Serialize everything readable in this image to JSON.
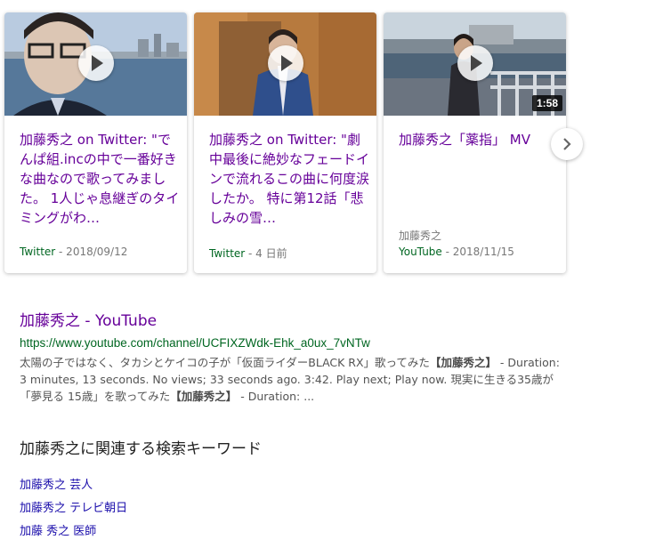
{
  "carousel": {
    "cards": [
      {
        "title": "加藤秀之 on Twitter: \"でんぱ組.incの中で一番好きな曲なので歌ってみました。 1人じゃ息継ぎのタイミングがわ…",
        "author": "",
        "source": "Twitter",
        "date": " - 2018/09/12",
        "duration": ""
      },
      {
        "title": "加藤秀之 on Twitter: \"劇中最後に絶妙なフェードインで流れるこの曲に何度涙したか。 特に第12話「悲しみの雪…",
        "author": "",
        "source": "Twitter",
        "date": " - 4 日前",
        "duration": ""
      },
      {
        "title": "加藤秀之「薬指」 MV",
        "author": "加藤秀之",
        "source": "YouTube",
        "date": " - 2018/11/15",
        "duration": "1:58"
      }
    ]
  },
  "result": {
    "title": "加藤秀之 - YouTube",
    "url": "https://www.youtube.com/channel/UCFIXZWdk-Ehk_a0ux_7vNTw",
    "snippet_parts": [
      "太陽の子ではなく、タカシとケイコの子が「仮面ライダーBLACK RX」歌ってみた",
      "【加藤秀之】",
      " - Duration: 3 minutes, 13 seconds. No views; 33 seconds ago. 3:42. Play next; Play now. 現実に生きる35歳が「夢見る 15歳」を歌ってみた",
      "【加藤秀之】",
      " - Duration: ..."
    ]
  },
  "related": {
    "heading": "加藤秀之に関連する検索キーワード",
    "items": [
      "加藤秀之 芸人",
      "加藤秀之 テレビ朝日",
      "加藤 秀之 医師"
    ]
  },
  "colors": {
    "visited_link": "#660099",
    "link": "#1a0dab",
    "url_green": "#006621",
    "snippet_gray": "#545454"
  }
}
